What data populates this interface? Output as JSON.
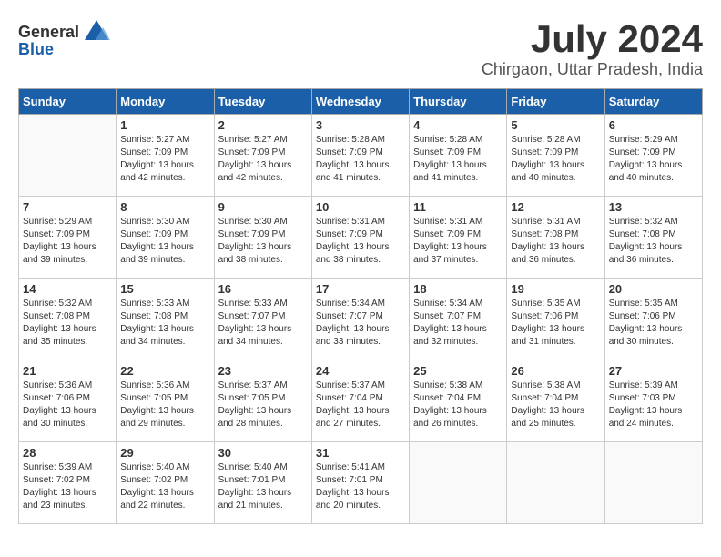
{
  "logo": {
    "general": "General",
    "blue": "Blue"
  },
  "title": "July 2024",
  "subtitle": "Chirgaon, Uttar Pradesh, India",
  "days_of_week": [
    "Sunday",
    "Monday",
    "Tuesday",
    "Wednesday",
    "Thursday",
    "Friday",
    "Saturday"
  ],
  "weeks": [
    [
      {
        "day": "",
        "sunrise": "",
        "sunset": "",
        "daylight": "",
        "empty": true
      },
      {
        "day": "1",
        "sunrise": "5:27 AM",
        "sunset": "7:09 PM",
        "daylight": "13 hours and 42 minutes."
      },
      {
        "day": "2",
        "sunrise": "5:27 AM",
        "sunset": "7:09 PM",
        "daylight": "13 hours and 42 minutes."
      },
      {
        "day": "3",
        "sunrise": "5:28 AM",
        "sunset": "7:09 PM",
        "daylight": "13 hours and 41 minutes."
      },
      {
        "day": "4",
        "sunrise": "5:28 AM",
        "sunset": "7:09 PM",
        "daylight": "13 hours and 41 minutes."
      },
      {
        "day": "5",
        "sunrise": "5:28 AM",
        "sunset": "7:09 PM",
        "daylight": "13 hours and 40 minutes."
      },
      {
        "day": "6",
        "sunrise": "5:29 AM",
        "sunset": "7:09 PM",
        "daylight": "13 hours and 40 minutes."
      }
    ],
    [
      {
        "day": "7",
        "sunrise": "5:29 AM",
        "sunset": "7:09 PM",
        "daylight": "13 hours and 39 minutes."
      },
      {
        "day": "8",
        "sunrise": "5:30 AM",
        "sunset": "7:09 PM",
        "daylight": "13 hours and 39 minutes."
      },
      {
        "day": "9",
        "sunrise": "5:30 AM",
        "sunset": "7:09 PM",
        "daylight": "13 hours and 38 minutes."
      },
      {
        "day": "10",
        "sunrise": "5:31 AM",
        "sunset": "7:09 PM",
        "daylight": "13 hours and 38 minutes."
      },
      {
        "day": "11",
        "sunrise": "5:31 AM",
        "sunset": "7:09 PM",
        "daylight": "13 hours and 37 minutes."
      },
      {
        "day": "12",
        "sunrise": "5:31 AM",
        "sunset": "7:08 PM",
        "daylight": "13 hours and 36 minutes."
      },
      {
        "day": "13",
        "sunrise": "5:32 AM",
        "sunset": "7:08 PM",
        "daylight": "13 hours and 36 minutes."
      }
    ],
    [
      {
        "day": "14",
        "sunrise": "5:32 AM",
        "sunset": "7:08 PM",
        "daylight": "13 hours and 35 minutes."
      },
      {
        "day": "15",
        "sunrise": "5:33 AM",
        "sunset": "7:08 PM",
        "daylight": "13 hours and 34 minutes."
      },
      {
        "day": "16",
        "sunrise": "5:33 AM",
        "sunset": "7:07 PM",
        "daylight": "13 hours and 34 minutes."
      },
      {
        "day": "17",
        "sunrise": "5:34 AM",
        "sunset": "7:07 PM",
        "daylight": "13 hours and 33 minutes."
      },
      {
        "day": "18",
        "sunrise": "5:34 AM",
        "sunset": "7:07 PM",
        "daylight": "13 hours and 32 minutes."
      },
      {
        "day": "19",
        "sunrise": "5:35 AM",
        "sunset": "7:06 PM",
        "daylight": "13 hours and 31 minutes."
      },
      {
        "day": "20",
        "sunrise": "5:35 AM",
        "sunset": "7:06 PM",
        "daylight": "13 hours and 30 minutes."
      }
    ],
    [
      {
        "day": "21",
        "sunrise": "5:36 AM",
        "sunset": "7:06 PM",
        "daylight": "13 hours and 30 minutes."
      },
      {
        "day": "22",
        "sunrise": "5:36 AM",
        "sunset": "7:05 PM",
        "daylight": "13 hours and 29 minutes."
      },
      {
        "day": "23",
        "sunrise": "5:37 AM",
        "sunset": "7:05 PM",
        "daylight": "13 hours and 28 minutes."
      },
      {
        "day": "24",
        "sunrise": "5:37 AM",
        "sunset": "7:04 PM",
        "daylight": "13 hours and 27 minutes."
      },
      {
        "day": "25",
        "sunrise": "5:38 AM",
        "sunset": "7:04 PM",
        "daylight": "13 hours and 26 minutes."
      },
      {
        "day": "26",
        "sunrise": "5:38 AM",
        "sunset": "7:04 PM",
        "daylight": "13 hours and 25 minutes."
      },
      {
        "day": "27",
        "sunrise": "5:39 AM",
        "sunset": "7:03 PM",
        "daylight": "13 hours and 24 minutes."
      }
    ],
    [
      {
        "day": "28",
        "sunrise": "5:39 AM",
        "sunset": "7:02 PM",
        "daylight": "13 hours and 23 minutes."
      },
      {
        "day": "29",
        "sunrise": "5:40 AM",
        "sunset": "7:02 PM",
        "daylight": "13 hours and 22 minutes."
      },
      {
        "day": "30",
        "sunrise": "5:40 AM",
        "sunset": "7:01 PM",
        "daylight": "13 hours and 21 minutes."
      },
      {
        "day": "31",
        "sunrise": "5:41 AM",
        "sunset": "7:01 PM",
        "daylight": "13 hours and 20 minutes."
      },
      {
        "day": "",
        "empty": true
      },
      {
        "day": "",
        "empty": true
      },
      {
        "day": "",
        "empty": true
      }
    ]
  ]
}
